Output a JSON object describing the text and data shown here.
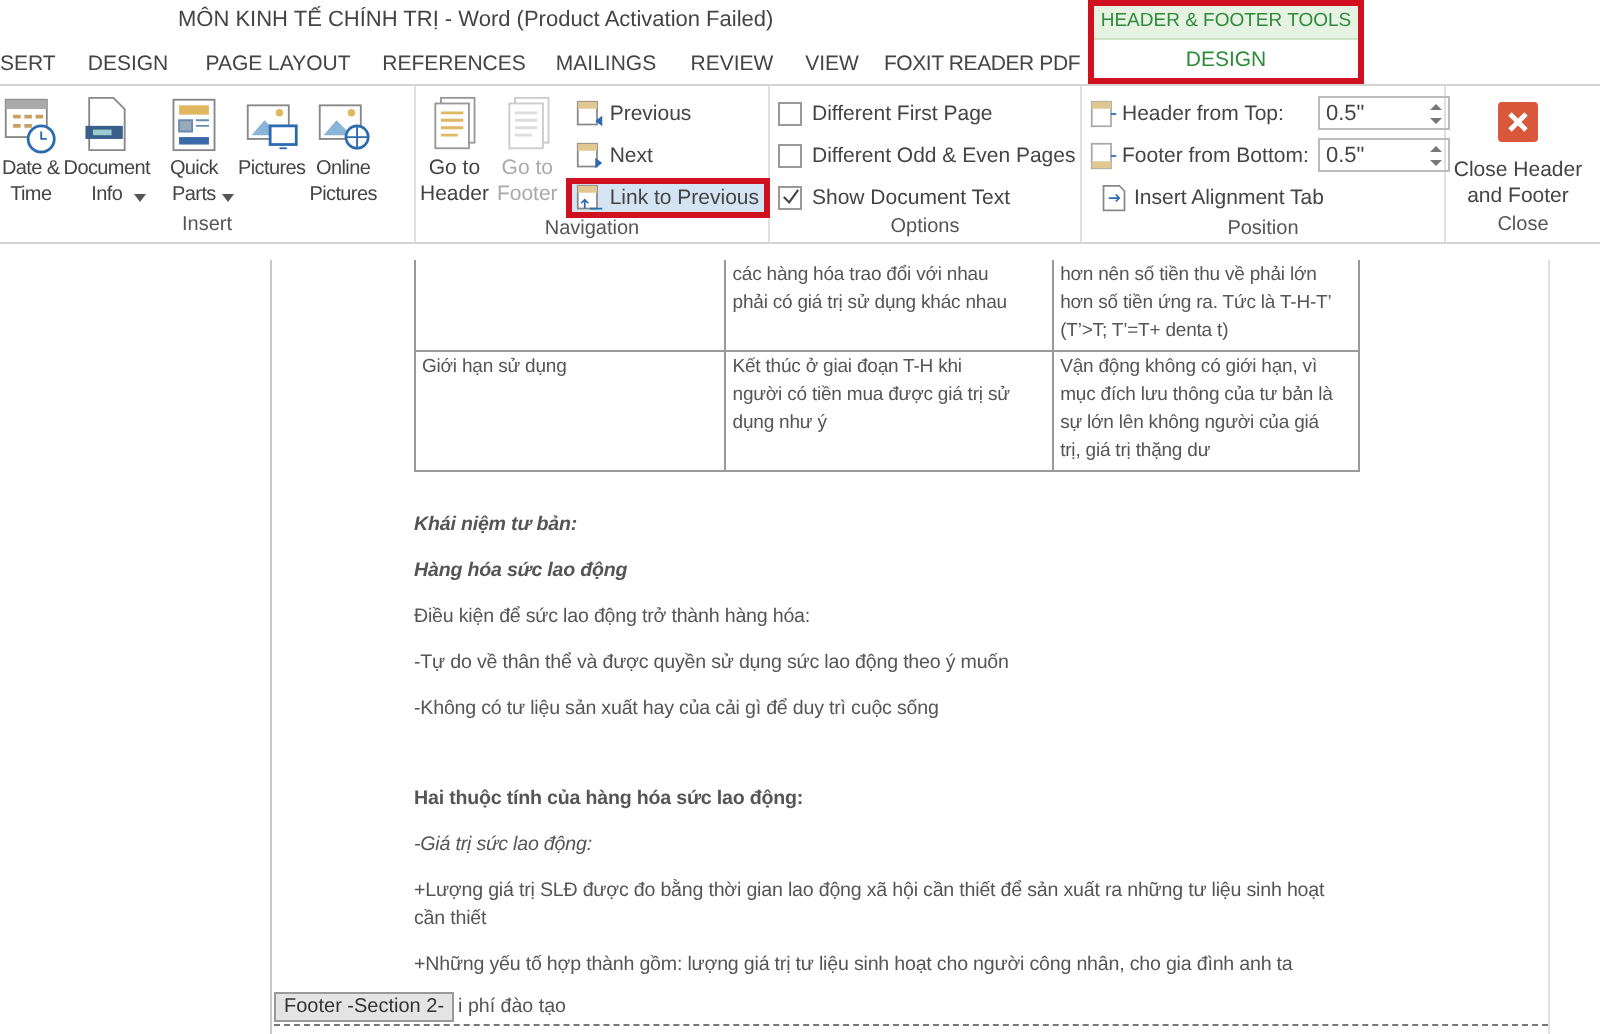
{
  "window": {
    "title": "MÔN KINH TẾ CHÍNH TRỊ - Word (Product Activation Failed)"
  },
  "tabs": [
    {
      "label": "SERT",
      "selected": false
    },
    {
      "label": "DESIGN",
      "selected": false
    },
    {
      "label": "PAGE LAYOUT",
      "selected": false
    },
    {
      "label": "REFERENCES",
      "selected": false
    },
    {
      "label": "MAILINGS",
      "selected": false
    },
    {
      "label": "REVIEW",
      "selected": false
    },
    {
      "label": "VIEW",
      "selected": false
    },
    {
      "label": "FOXIT READER PDF",
      "selected": false
    }
  ],
  "contextual_tab": {
    "group_label": "HEADER & FOOTER TOOLS",
    "label": "DESIGN",
    "selected": true,
    "highlighted": true
  },
  "ribbon": {
    "insert": {
      "label": "Insert",
      "buttons": [
        {
          "label": "Date &\nTime",
          "dropdown": false
        },
        {
          "label": "Document\nInfo",
          "dropdown": true
        },
        {
          "label": "Quick\nParts",
          "dropdown": true
        },
        {
          "label": "Pictures",
          "dropdown": false
        },
        {
          "label": "Online\nPictures",
          "dropdown": false
        }
      ]
    },
    "navigation": {
      "label": "Navigation",
      "large": [
        {
          "label": "Go to\nHeader",
          "disabled": false
        },
        {
          "label": "Go to\nFooter",
          "disabled": true
        }
      ],
      "small": [
        {
          "label": "Previous",
          "highlighted": false
        },
        {
          "label": "Next",
          "highlighted": false
        },
        {
          "label": "Link to Previous",
          "highlighted": true
        }
      ]
    },
    "options": {
      "label": "Options",
      "checkboxes": [
        {
          "label": "Different First Page",
          "checked": false
        },
        {
          "label": "Different Odd & Even Pages",
          "checked": false
        },
        {
          "label": "Show Document Text",
          "checked": true
        }
      ]
    },
    "position": {
      "label": "Position",
      "fields": [
        {
          "label": "Header from Top:",
          "value": "0.5\""
        },
        {
          "label": "Footer from Bottom:",
          "value": "0.5\""
        }
      ],
      "button": "Insert Alignment Tab"
    },
    "close": {
      "label": "Close",
      "button": "Close Header\nand Footer"
    }
  },
  "document": {
    "table": {
      "rows": [
        {
          "column_2": "các hàng hóa trao đổi với nhau\nphải có giá trị sử dụng khác nhau",
          "column_3": "hơn nên số tiền thu về phải lớn\nhơn số tiền ứng ra. Tức là T-H-T’\n(T’>T; T’=T+ denta t)"
        },
        {
          "column_1": "Giới hạn sử dụng",
          "column_2": "Kết thúc ở giai đoạn T-H khi\nngười có tiền mua được giá trị sử\ndụng như ý",
          "column_3": "Vận động không có giới hạn, vì\nmục đích lưu thông của tư bản là\nsự lớn lên không người của giá\ntrị, giá trị thặng dư"
        }
      ]
    },
    "paragraphs": [
      {
        "kind": "bold-italic",
        "text": "Khái niệm tư bản:"
      },
      {
        "kind": "bold-italic",
        "text": "Hàng hóa sức lao động"
      },
      {
        "kind": "normal",
        "text": "Điều kiện để sức lao động trở thành hàng hóa:"
      },
      {
        "kind": "normal",
        "text": "-Tự do về thân thể và được quyền sử dụng sức lao động theo ý muốn"
      },
      {
        "kind": "normal",
        "text": "-Không có tư liệu sản xuất hay của cải gì để duy trì cuộc sống"
      },
      {
        "kind": "gap"
      },
      {
        "kind": "bold",
        "text": "Hai thuộc tính của hàng hóa sức lao động:"
      },
      {
        "kind": "italic",
        "text": "-Giá trị sức lao động:"
      },
      {
        "kind": "normal",
        "text": "+Lượng giá trị SLĐ được đo bằng thời gian lao động xã hội cần thiết để sản xuất ra những tư liệu sinh hoạt\ncần thiết"
      },
      {
        "kind": "normal",
        "text": "+Những yếu tố hợp thành gồm: lượng giá trị tư liệu sinh hoạt cho người công nhân, cho gia đình anh ta"
      }
    ],
    "footer_tag": "Footer -Section 2-",
    "covered_line": "i phí đào tạo"
  }
}
